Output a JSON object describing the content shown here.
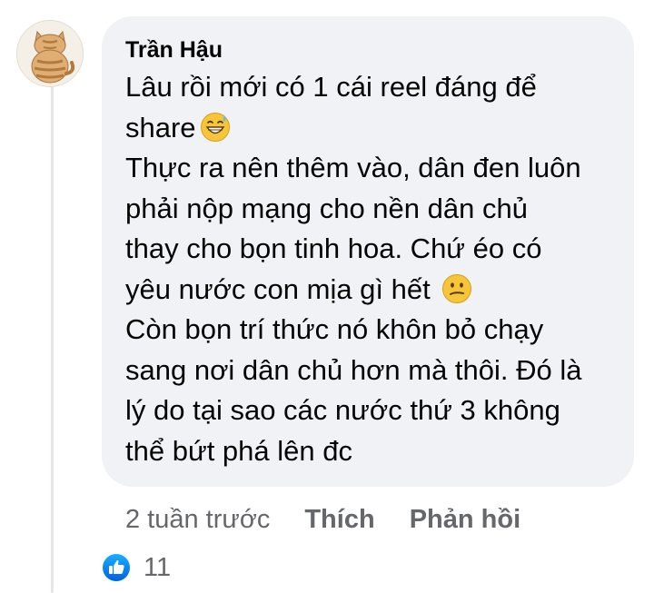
{
  "comment": {
    "author": "Trần Hậu",
    "lines": [
      "Lâu rồi mới có 1 cái reel đáng để",
      "share",
      "Thực ra nên thêm vào, dân đen luôn",
      "phải nộp mạng cho nền dân chủ",
      "thay cho bọn tinh hoa. Chứ éo có",
      "yêu nước con mịa gì hết",
      "Còn bọn trí thức nó khôn bỏ chạy",
      "sang nơi dân chủ hơn mà thôi. Đó là",
      "lý do tại sao các nước thứ 3 không",
      "thể bứt phá lên đc"
    ],
    "emojis": {
      "after_line_2": "grinning-sweat-emoji",
      "after_line_6": "confused-face-emoji"
    }
  },
  "actions": {
    "time": "2 tuần trước",
    "like_label": "Thích",
    "reply_label": "Phản hồi"
  },
  "reactions": {
    "icon": "like-thumb-icon",
    "count": "11"
  },
  "colors": {
    "bubble": "#f0f2f5",
    "secondary_text": "#65676b",
    "primary_text": "#050505",
    "like_blue": "#1877f2"
  }
}
